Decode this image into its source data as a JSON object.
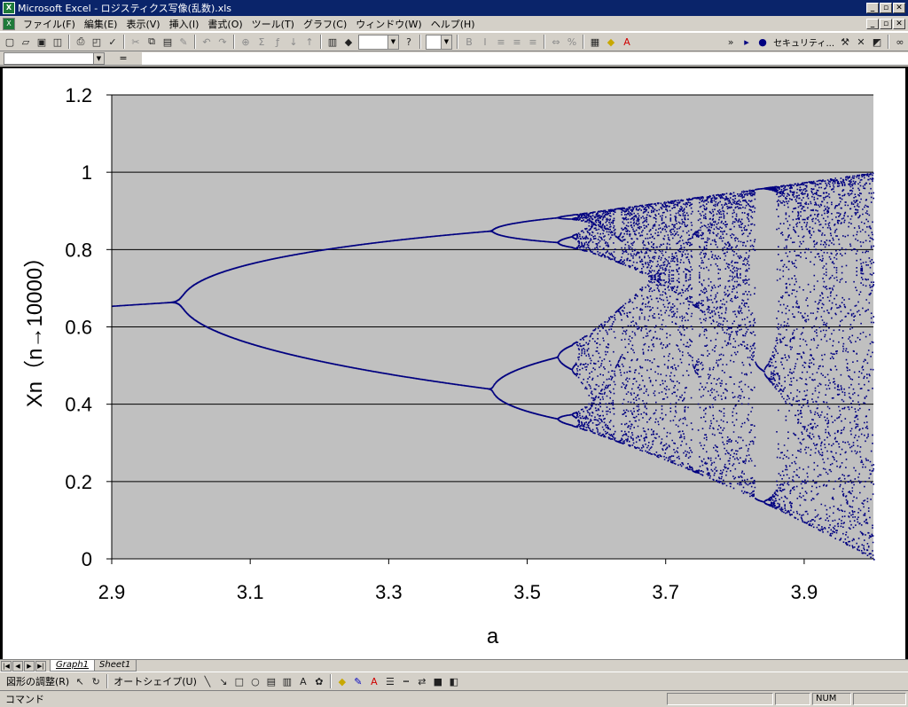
{
  "window": {
    "title": "Microsoft Excel - ロジスティクス写像(乱数).xls",
    "app_icon": "excel-icon",
    "controls": [
      "_",
      "▫",
      "✕"
    ]
  },
  "menubar": {
    "items": [
      "ファイル(F)",
      "編集(E)",
      "表示(V)",
      "挿入(I)",
      "書式(O)",
      "ツール(T)",
      "グラフ(C)",
      "ウィンドウ(W)",
      "ヘルプ(H)"
    ]
  },
  "toolbar": {
    "security_label": "セキュリティ..."
  },
  "formula_bar": {
    "equals": "="
  },
  "sheet_tabs": {
    "tabs": [
      "Graph1",
      "Sheet1"
    ],
    "active": "Graph1"
  },
  "drawing_toolbar": {
    "draw_menu": "図形の調整(R)",
    "autoshape_menu": "オートシェイプ(U)"
  },
  "status_bar": {
    "text": "コマンド",
    "num": "NUM"
  },
  "colors": {
    "plot_area": "#c0c0c0",
    "series": "#000080",
    "gridline": "#000000"
  },
  "chart_data": {
    "type": "scatter",
    "title": "",
    "xlabel": "a",
    "ylabel": "Xn（n→10000）",
    "xlim": [
      2.9,
      4.0
    ],
    "ylim": [
      0,
      1.2
    ],
    "x_ticks": [
      "2.9",
      "3.1",
      "3.3",
      "3.5",
      "3.7",
      "3.9"
    ],
    "y_ticks": [
      "0",
      "0.2",
      "0.4",
      "0.6",
      "0.8",
      "1",
      "1.2"
    ],
    "grid": "horizontal",
    "legend": "none",
    "series": [
      {
        "name": "",
        "description_points": [
          {
            "a": 2.9,
            "x": 0.655
          },
          {
            "a": 3.0,
            "x": 0.667
          },
          {
            "a": 3.1,
            "x": 0.558
          },
          {
            "a": 3.1,
            "x": 0.765
          },
          {
            "a": 3.3,
            "x": 0.479
          },
          {
            "a": 3.3,
            "x": 0.824
          },
          {
            "a": 3.45,
            "x": 0.44
          },
          {
            "a": 3.45,
            "x": 0.85
          },
          {
            "a": 3.5,
            "x": 0.383
          },
          {
            "a": 3.5,
            "x": 0.501
          },
          {
            "a": 3.5,
            "x": 0.827
          },
          {
            "a": 3.5,
            "x": 0.875
          },
          {
            "a": 3.83,
            "x": 0.156
          },
          {
            "a": 3.83,
            "x": 0.505
          },
          {
            "a": 3.83,
            "x": 0.957
          },
          {
            "a": 4.0,
            "x": 0.0
          },
          {
            "a": 4.0,
            "x": 1.0
          }
        ]
      }
    ]
  }
}
